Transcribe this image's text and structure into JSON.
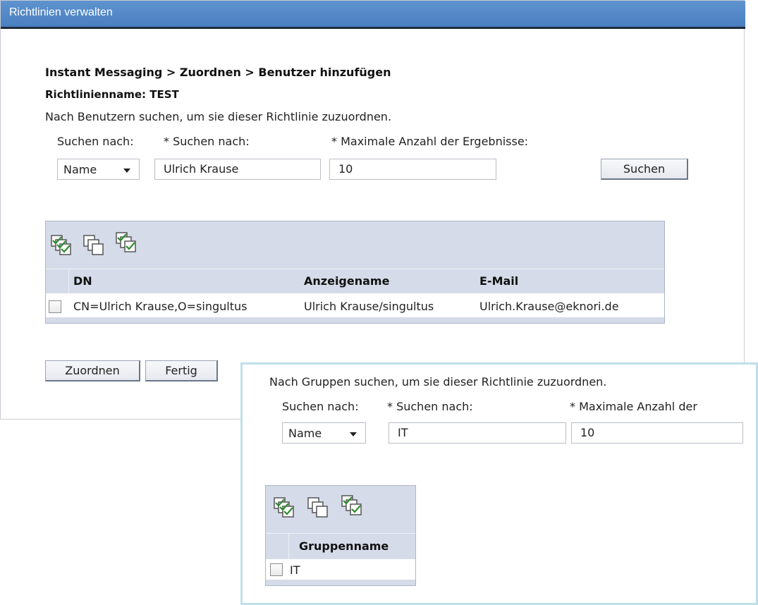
{
  "window": {
    "title": "Richtlinien verwalten"
  },
  "main": {
    "breadcrumb": "Instant Messaging > Zuordnen > Benutzer hinzufügen",
    "policy_name": "Richtlinienname: TEST",
    "instruction": "Nach Benutzern suchen, um sie dieser Richtlinie zuzuordnen.",
    "search": {
      "by_label": "Suchen nach:",
      "by_value": "Name",
      "term_label": "* Suchen nach:",
      "term_value": "Ulrich Krause",
      "max_label": "* Maximale Anzahl der Ergebnisse:",
      "max_value": "10",
      "button": "Suchen"
    },
    "table": {
      "toolbar_icons": [
        "select-all-icon",
        "deselect-all-icon",
        "invert-selection-icon"
      ],
      "columns": [
        "DN",
        "Anzeigename",
        "E-Mail"
      ],
      "rows": [
        {
          "checked": false,
          "dn": "CN=Ulrich Krause,O=singultus",
          "display_name": "Ulrich Krause/singultus",
          "email": "Ulrich.Krause@eknori.de"
        }
      ]
    },
    "buttons": {
      "assign": "Zuordnen",
      "done": "Fertig"
    }
  },
  "overlay": {
    "instruction": "Nach Gruppen suchen, um sie dieser Richtlinie zuzuordnen.",
    "search": {
      "by_label": "Suchen nach:",
      "by_value": "Name",
      "term_label": "* Suchen nach:",
      "term_value": "IT",
      "max_label": "* Maximale Anzahl der",
      "max_value": "10"
    },
    "table": {
      "toolbar_icons": [
        "select-all-icon",
        "deselect-all-icon",
        "invert-selection-icon"
      ],
      "columns": [
        "Gruppenname"
      ],
      "rows": [
        {
          "checked": false,
          "name": "IT"
        }
      ]
    }
  }
}
